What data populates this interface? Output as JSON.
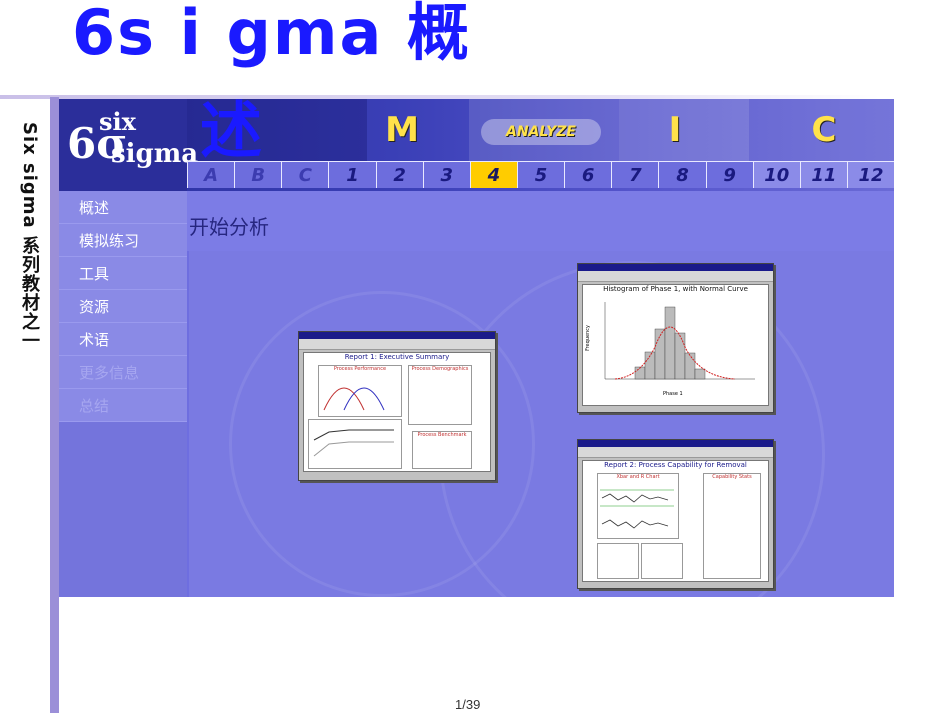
{
  "slide": {
    "title": "6s i gma 概",
    "title_wrap": "述",
    "vertical_label": "Six sigma 系列教材之一",
    "page_number": "1/39"
  },
  "banner": {
    "logo_digit": "6σ",
    "logo_top": "six",
    "logo_bottom": "sigma",
    "phases": {
      "measure": "M",
      "analyze": "ANALYZE",
      "improve": "I",
      "control": "C"
    },
    "steps": [
      {
        "label": "A",
        "state": "dim"
      },
      {
        "label": "B",
        "state": "dim"
      },
      {
        "label": "C",
        "state": "dim"
      },
      {
        "label": "1",
        "state": "normal"
      },
      {
        "label": "2",
        "state": "normal"
      },
      {
        "label": "3",
        "state": "normal"
      },
      {
        "label": "4",
        "state": "active"
      },
      {
        "label": "5",
        "state": "normal"
      },
      {
        "label": "6",
        "state": "normal"
      },
      {
        "label": "7",
        "state": "normal"
      },
      {
        "label": "8",
        "state": "normal"
      },
      {
        "label": "9",
        "state": "normal"
      },
      {
        "label": "10",
        "state": "light"
      },
      {
        "label": "11",
        "state": "light"
      },
      {
        "label": "12",
        "state": "light"
      }
    ],
    "active_color": "#ffcc00"
  },
  "side_menu": {
    "items": [
      {
        "label": "概述",
        "enabled": true
      },
      {
        "label": "模拟练习",
        "enabled": true
      },
      {
        "label": "工具",
        "enabled": true
      },
      {
        "label": "资源",
        "enabled": true
      },
      {
        "label": "术语",
        "enabled": true
      },
      {
        "label": "更多信息",
        "enabled": false
      },
      {
        "label": "总结",
        "enabled": false
      }
    ]
  },
  "content": {
    "title": "开始分析",
    "screenshots": {
      "report1": {
        "heading": "Report 1: Executive Summary",
        "panel_left": "Process Performance",
        "panel_right": "Process Demographics",
        "panel_bottom": "Process Benchmark"
      },
      "histogram": {
        "heading": "Histogram of Phase 1, with Normal Curve",
        "xlabel": "Phase 1",
        "ylabel": "Frequency"
      },
      "report2": {
        "heading": "Report 2: Process Capability for Removal",
        "panel_left": "Xbar and R Chart",
        "panel_right": "Capability Stats"
      }
    }
  }
}
